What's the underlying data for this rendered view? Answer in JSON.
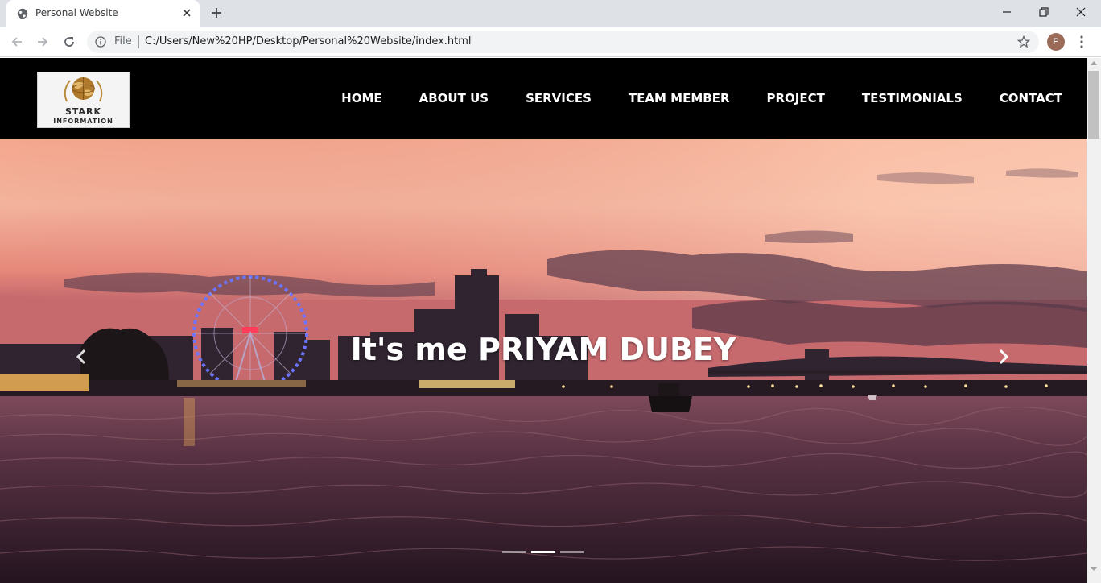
{
  "browser": {
    "tab_title": "Personal Website",
    "file_label": "File",
    "url": "C:/Users/New%20HP/Desktop/Personal%20Website/index.html",
    "profile_initial": "P"
  },
  "site": {
    "logo": {
      "line1": "STARK",
      "line2": "INFORMATION"
    },
    "nav": [
      "HOME",
      "ABOUT US",
      "SERVICES",
      "TEAM MEMBER",
      "PROJECT",
      "TESTIMONIALS",
      "CONTACT"
    ]
  },
  "hero": {
    "caption": "It's me PRIYAM DUBEY",
    "slide_count": 3,
    "active_slide": 2,
    "prev_label": "Previous",
    "next_label": "Next"
  },
  "colors": {
    "header_bg": "#000000",
    "nav_text": "#ffffff",
    "sky_top": "#f7b89a",
    "sky_mid": "#e07a6c",
    "water": "#3d2230"
  },
  "icons": {
    "favicon": "globe-icon",
    "tab_close": "close-icon",
    "new_tab": "plus-icon",
    "back": "arrow-left-icon",
    "forward": "arrow-right-icon",
    "reload": "reload-icon",
    "info": "info-icon",
    "bookmark": "star-icon",
    "menu": "menu-dots-icon",
    "prev": "chevron-left-icon",
    "next": "chevron-right-icon"
  }
}
